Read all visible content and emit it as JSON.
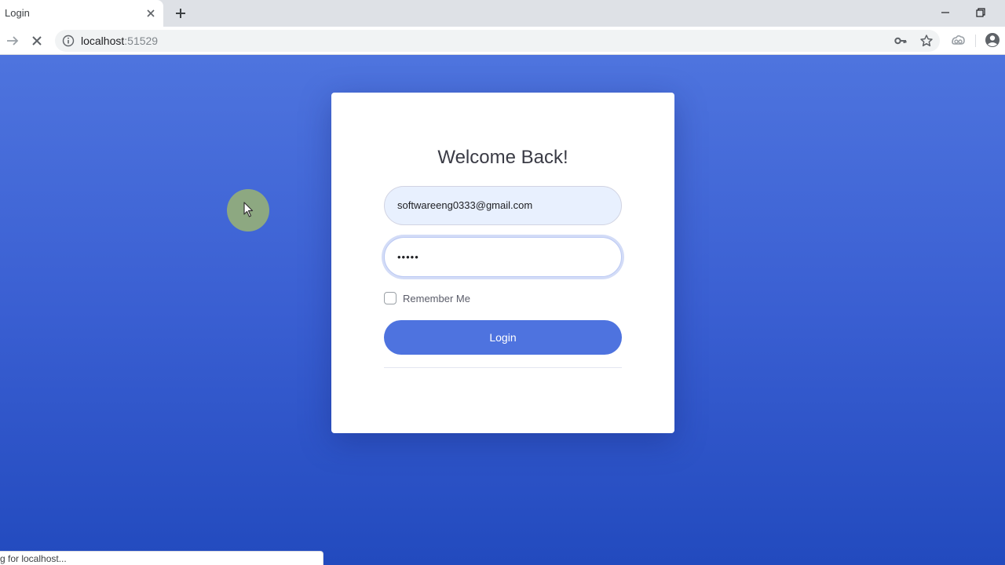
{
  "browser": {
    "tab_title": "Login",
    "url_host": "localhost",
    "url_port": ":51529",
    "status_text": "g for localhost..."
  },
  "icons": {
    "tab_close": "close-icon",
    "new_tab": "plus-icon",
    "minimize": "minimize-icon",
    "restore": "restore-icon",
    "forward": "arrow-right-icon",
    "stop": "stop-icon",
    "site_info": "info-icon",
    "password_key": "key-icon",
    "bookmark": "star-icon",
    "extension": "extension-icon",
    "profile": "profile-icon",
    "pointer": "cursor-icon"
  },
  "login": {
    "title": "Welcome Back!",
    "email_value": "softwareeng0333@gmail.com",
    "password_value": "•••••",
    "remember_label": "Remember Me",
    "remember_checked": false,
    "button_label": "Login"
  },
  "colors": {
    "primary": "#4e73df",
    "gradient_top": "#4e74de",
    "gradient_bottom": "#224abe",
    "autofill_bg": "#e8f0fe"
  }
}
